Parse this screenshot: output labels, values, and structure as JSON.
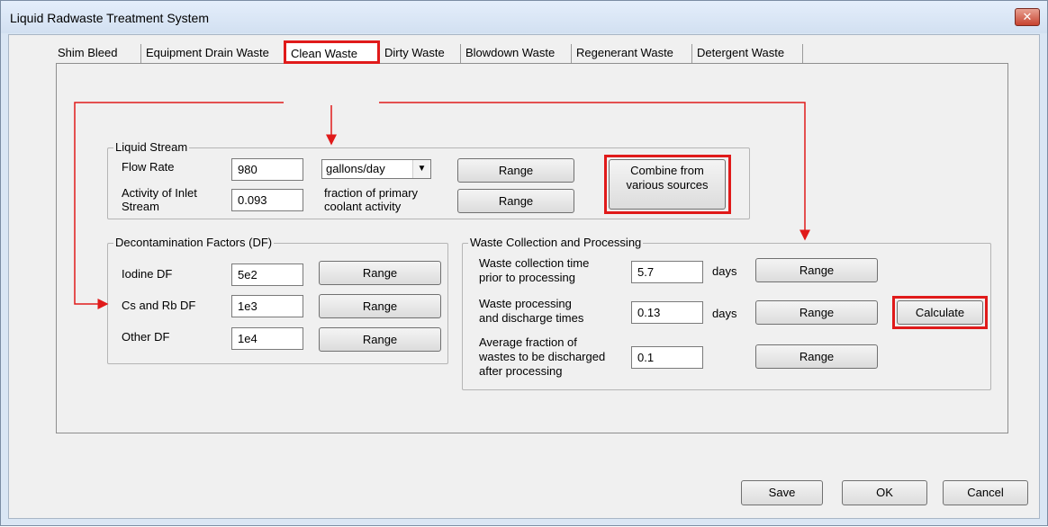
{
  "window": {
    "title": "Liquid Radwaste Treatment System",
    "close_label": "✕"
  },
  "tabs": [
    {
      "label": "Shim Bleed"
    },
    {
      "label": "Equipment Drain Waste"
    },
    {
      "label": "Clean Waste",
      "active": true
    },
    {
      "label": "Dirty Waste"
    },
    {
      "label": "Blowdown Waste"
    },
    {
      "label": "Regenerant Waste"
    },
    {
      "label": "Detergent Waste"
    }
  ],
  "liquid_stream": {
    "title": "Liquid Stream",
    "flow_rate": {
      "label": "Flow Rate",
      "value": "980",
      "unit": "gallons/day",
      "range_label": "Range"
    },
    "activity": {
      "label_line1": "Activity of Inlet",
      "label_line2": "Stream",
      "value": "0.093",
      "unit_line1": "fraction of primary",
      "unit_line2": "coolant activity",
      "range_label": "Range"
    },
    "combine_line1": "Combine from",
    "combine_line2": "various sources"
  },
  "df": {
    "title": "Decontamination Factors (DF)",
    "rows": [
      {
        "label": "Iodine DF",
        "value": "5e2",
        "range_label": "Range"
      },
      {
        "label": "Cs and Rb DF",
        "value": "1e3",
        "range_label": "Range"
      },
      {
        "label": "Other  DF",
        "value": "1e4",
        "range_label": "Range"
      }
    ]
  },
  "waste": {
    "title": "Waste Collection and Processing",
    "collection": {
      "line1": "Waste collection time",
      "line2": "prior to processing",
      "value": "5.7",
      "unit": "days",
      "range_label": "Range"
    },
    "processing": {
      "line1": "Waste processing",
      "line2": "and discharge times",
      "value": "0.13",
      "unit": "days",
      "range_label": "Range"
    },
    "fraction": {
      "line1": "Average fraction of",
      "line2": "wastes to be discharged",
      "line3": "after processing",
      "value": "0.1",
      "range_label": "Range"
    },
    "calculate_label": "Calculate"
  },
  "footer": {
    "save_label": "Save",
    "ok_label": "OK",
    "cancel_label": "Cancel"
  },
  "colors": {
    "highlight": "#e01a1a",
    "titlebar": "#dae6f4",
    "client": "#f0f0f0"
  }
}
